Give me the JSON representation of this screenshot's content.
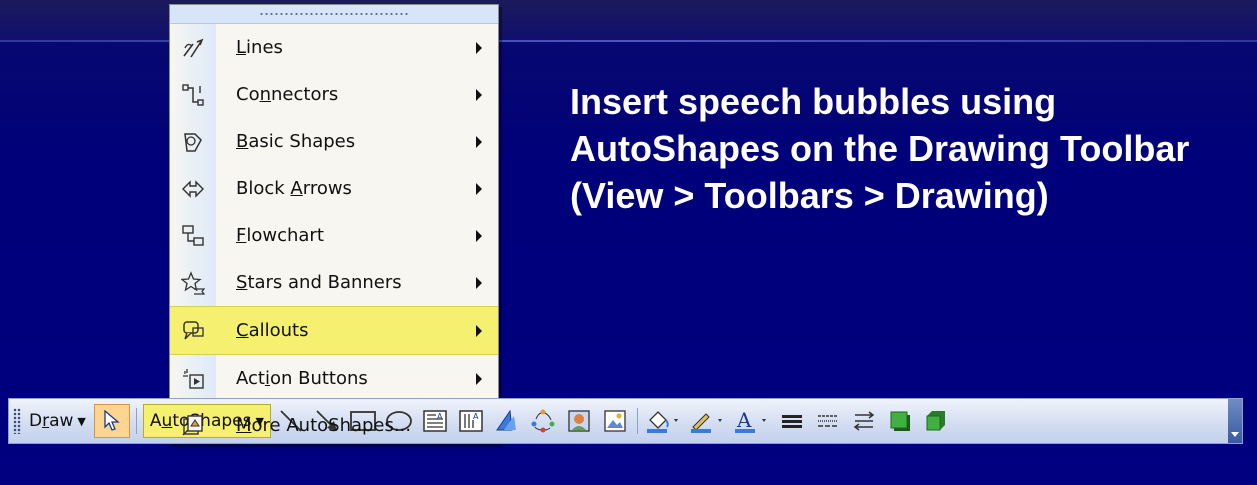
{
  "slide": {
    "text": "Insert speech bubbles using AutoShapes on the Drawing Toolbar (View > Toolbars > Drawing)"
  },
  "menu": {
    "items": [
      {
        "pre": "",
        "u": "L",
        "post": "ines",
        "icon": "lines-icon",
        "highlighted": false
      },
      {
        "pre": "Co",
        "u": "n",
        "post": "nectors",
        "icon": "connectors-icon",
        "highlighted": false
      },
      {
        "pre": "",
        "u": "B",
        "post": "asic Shapes",
        "icon": "basic-shapes-icon",
        "highlighted": false
      },
      {
        "pre": "Block ",
        "u": "A",
        "post": "rrows",
        "icon": "block-arrows-icon",
        "highlighted": false
      },
      {
        "pre": "",
        "u": "F",
        "post": "lowchart",
        "icon": "flowchart-icon",
        "highlighted": false
      },
      {
        "pre": "",
        "u": "S",
        "post": "tars and Banners",
        "icon": "stars-banners-icon",
        "highlighted": false
      },
      {
        "pre": "",
        "u": "C",
        "post": "allouts",
        "icon": "callouts-icon",
        "highlighted": true
      },
      {
        "pre": "Act",
        "u": "i",
        "post": "on Buttons",
        "icon": "action-buttons-icon",
        "highlighted": false
      },
      {
        "pre": "",
        "u": "M",
        "post": "ore AutoShapes...",
        "icon": "more-autoshapes-icon",
        "highlighted": false
      }
    ]
  },
  "toolbar": {
    "draw_pre": "D",
    "draw_u": "r",
    "draw_post": "aw",
    "autoshapes_pre": "A",
    "autoshapes_u": "u",
    "autoshapes_post": "toShapes",
    "icons": [
      "line-icon",
      "arrow-icon",
      "rectangle-icon",
      "oval-icon",
      "text-box-icon",
      "vertical-text-box-icon",
      "wordart-icon",
      "diagram-icon",
      "clip-art-icon",
      "insert-picture-icon",
      "fill-color-icon",
      "line-color-icon",
      "font-color-icon",
      "line-style-icon",
      "dash-style-icon",
      "arrow-style-icon",
      "shadow-style-icon",
      "3d-style-icon"
    ]
  },
  "colors": {
    "background": "#000080",
    "menu_highlight": "#f6f070",
    "toolbar_bg": "#d4def2",
    "text": "#ffffff"
  }
}
